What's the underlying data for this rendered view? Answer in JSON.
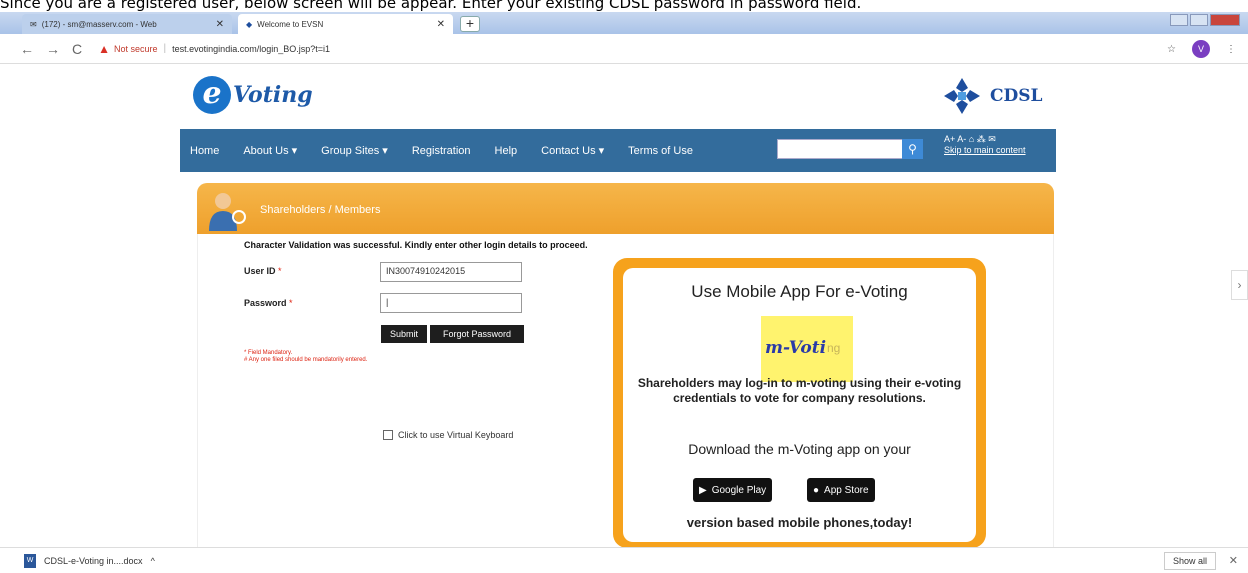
{
  "caption": "Since you are a registered user, below screen will be appear. Enter your existing CDSL password in password field.",
  "browser": {
    "tabs": [
      {
        "label": "(172) - sm@masserv.com - Web"
      },
      {
        "label": "Welcome to EVSN"
      }
    ],
    "new_tab": "+",
    "security": "Not secure",
    "url": "test.evotingindia.com/login_BO.jsp?t=i1",
    "profile_initial": "V"
  },
  "site": {
    "logo_letter": "e",
    "logo_word": "Voting",
    "cdsl": "CDSL",
    "nav": [
      "Home",
      "About Us ▾",
      "Group Sites ▾",
      "Registration",
      "Help",
      "Contact Us ▾",
      "Terms of Use"
    ],
    "access": {
      "sizes": "A+ A- ",
      "skip": "Skip to main content"
    }
  },
  "panel": {
    "title": "Shareholders / Members",
    "message": "Character Validation was successful. Kindly enter other login details to proceed.",
    "userid_label": "User ID",
    "userid_value": "IN30074910242015",
    "password_label": "Password",
    "required_mark": "*",
    "submit": "Submit",
    "forgot": "Forgot Password",
    "note1": "* Field Mandatory.",
    "note2": "# Any one filed should be mandatorily entered.",
    "virtual_keyboard": "Click to use Virtual Keyboard"
  },
  "promo": {
    "heading": "Use Mobile App For e-Voting",
    "logo_text": "m-Voti",
    "logo_tail": "ng",
    "desc": "Shareholders may log-in to m-voting using their e-voting credentials to vote for company resolutions.",
    "download": "Download the m-Voting app on your",
    "google_play": "Google Play",
    "app_store": "App Store",
    "version": "version based mobile phones,today!"
  },
  "downloads": {
    "file": "CDSL-e-Voting in....docx",
    "show_all": "Show all"
  },
  "colors": {
    "navbar": "#336c9c",
    "orange": "#f6a21c",
    "brand_blue": "#1e5aa8"
  }
}
